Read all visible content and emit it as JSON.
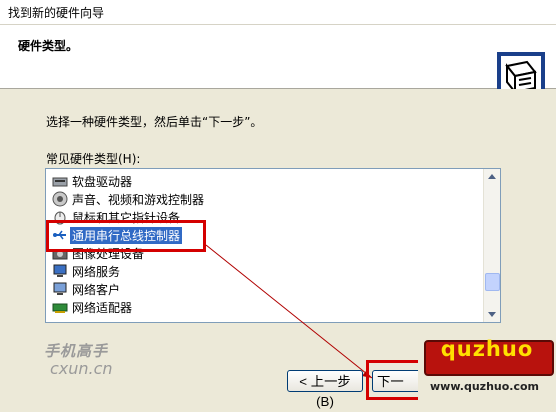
{
  "window": {
    "title": "找到新的硬件向导"
  },
  "header": {
    "title": "硬件类型。"
  },
  "main": {
    "instruction": "选择一种硬件类型，然后单击“下一步”。",
    "list_label": "常见硬件类型(H):",
    "items": [
      {
        "label": "软盘驱动器",
        "icon": "floppy-drive-icon"
      },
      {
        "label": "声音、视频和游戏控制器",
        "icon": "sound-icon"
      },
      {
        "label": "鼠标和其它指针设备",
        "icon": "mouse-icon"
      },
      {
        "label": "通用串行总线控制器",
        "icon": "usb-icon",
        "selected": true
      },
      {
        "label": "图像处理设备",
        "icon": "camera-icon"
      },
      {
        "label": "网络服务",
        "icon": "network-service-icon"
      },
      {
        "label": "网络客户",
        "icon": "network-client-icon"
      },
      {
        "label": "网络适配器",
        "icon": "network-adapter-icon"
      }
    ]
  },
  "buttons": {
    "back": "< 上一步(B)",
    "next": "下一"
  },
  "watermarks": {
    "left_top": "手机高手",
    "left_bottom": "cxun.cn",
    "brand": "quzhuo",
    "url": "www.quzhuo.com"
  },
  "colors": {
    "selection": "#316ac5",
    "highlight_red": "#d40000",
    "brand_red": "#b8120d",
    "brand_yellow": "#ffe000"
  }
}
